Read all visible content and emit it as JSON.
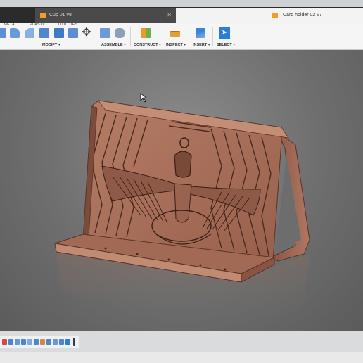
{
  "tabs": [
    {
      "label": "Cup 01 v8",
      "active": false
    },
    {
      "label": "Card holder 02 v7",
      "active": true
    }
  ],
  "toolbar": {
    "subtabs": [
      "T METAL",
      "PLASTIC",
      "UTILITIES"
    ],
    "groups": [
      "MODIFY",
      "ASSEMBLE",
      "CONSTRUCT",
      "INSPECT",
      "INSERT",
      "SELECT"
    ]
  },
  "colors": {
    "model": "#a8705c",
    "model_shadow": "#6e4536",
    "viewport": "#6e6e6e",
    "accent": "#2a7fd4"
  }
}
